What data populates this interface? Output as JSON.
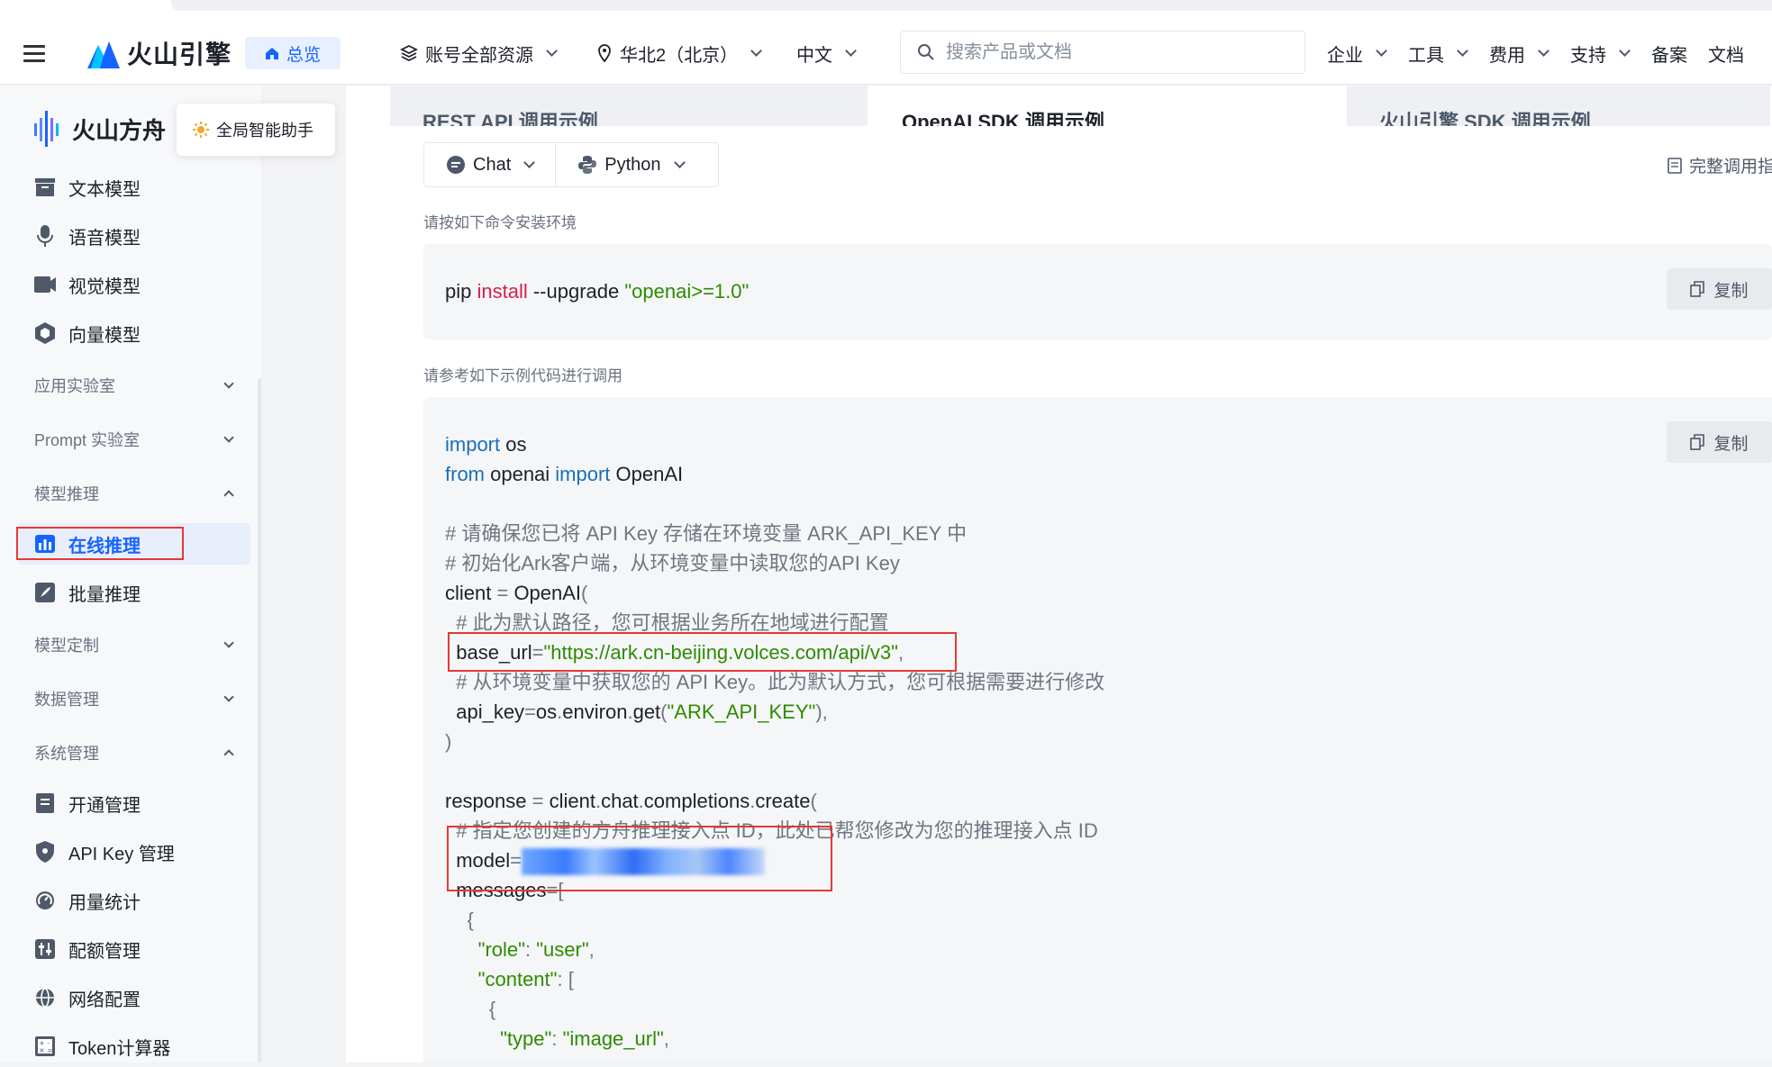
{
  "topbar": {
    "logo_text": "火山引擎",
    "overview_label": "总览",
    "resources_label": "账号全部资源",
    "region_label": "华北2（北京）",
    "language_label": "中文",
    "search_placeholder": "搜索产品或文档",
    "menu": [
      "企业",
      "工具",
      "费用",
      "支持",
      "备案",
      "文档"
    ]
  },
  "sidebar": {
    "brand": "火山方舟",
    "assistant": "全局智能助手",
    "items": {
      "text_model": "文本模型",
      "voice_model": "语音模型",
      "vision_model": "视觉模型",
      "vector_model": "向量模型",
      "online_inference": "在线推理",
      "batch_inference": "批量推理",
      "activation": "开通管理",
      "api_key": "API Key 管理",
      "usage": "用量统计",
      "quota": "配额管理",
      "network": "网络配置",
      "token_calc": "Token计算器"
    },
    "groups": {
      "app_lab": "应用实验室",
      "prompt_lab": "Prompt 实验室",
      "model_inference": "模型推理",
      "model_custom": "模型定制",
      "data_mgmt": "数据管理",
      "system_mgmt": "系统管理"
    }
  },
  "main": {
    "tabs": [
      "REST API 调用示例",
      "OpenAI SDK 调用示例",
      "火山引擎 SDK 调用示例"
    ],
    "selectors": {
      "api": "Chat",
      "language": "Python"
    },
    "doc_link": "完整调用指",
    "install_hint": "请按如下命令安装环境",
    "example_hint": "请参考如下示例代码进行调用",
    "copy_label": "复制",
    "install_cmd": {
      "p1": "pip ",
      "p2": "install",
      "p3": " --upgrade ",
      "p4": "\"openai>=1.0\""
    },
    "code": {
      "l1a": "import",
      "l1b": " os",
      "l2a": "from",
      "l2b": " openai ",
      "l2c": "import",
      "l2d": " OpenAI",
      "c1": "# 请确保您已将 API Key 存储在环境变量 ARK_API_KEY 中",
      "c2": "# 初始化Ark客户端，从环境变量中读取您的API Key",
      "l5a": "client",
      "l5b": " = ",
      "l5c": "OpenAI",
      "l5d": "(",
      "c3": "  # 此为默认路径，您可根据业务所在地域进行配置",
      "l7a": "  base_url",
      "l7b": "=",
      "l7c": "\"https://ark.cn-beijing.volces.com/api/v3\"",
      "l7d": ",",
      "c4": "  # 从环境变量中获取您的 API Key。此为默认方式，您可根据需要进行修改",
      "l9a": "  api_key",
      "l9b": "=",
      "l9c": "os",
      "l9d": ".",
      "l9e": "environ",
      "l9f": ".",
      "l9g": "get",
      "l9h": "(",
      "l9i": "\"ARK_API_KEY\"",
      "l9j": "),",
      "l10": ")",
      "l12a": "response",
      "l12b": " = ",
      "l12c": "client",
      "l12d": ".",
      "l12e": "chat",
      "l12f": ".",
      "l12g": "completions",
      "l12h": ".",
      "l12i": "create",
      "l12j": "(",
      "c5": "  # 指定您创建的方舟推理接入点 ID，此处已帮您修改为您的推理接入点 ID",
      "l14a": "  model",
      "l14b": "=",
      "l15a": "  messages",
      "l15b": "=[",
      "l16": "    {",
      "l17a": "      \"role\"",
      "l17b": ": ",
      "l17c": "\"user\"",
      "l17d": ",",
      "l18a": "      \"content\"",
      "l18b": ": [",
      "l19": "        {",
      "l20a": "          \"type\"",
      "l20b": ": ",
      "l20c": "\"image_url\"",
      "l20d": ","
    }
  },
  "colors": {
    "accent": "#1664ff",
    "highlight_box": "#e53935",
    "string": "#2e8b00",
    "keyword": "#1a6fb8"
  }
}
